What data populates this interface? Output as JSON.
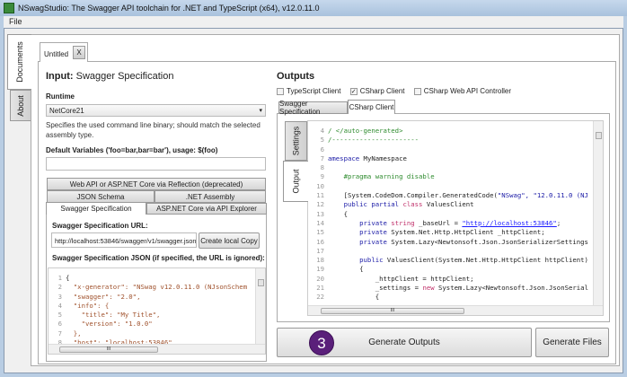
{
  "window": {
    "title": "NSwagStudio: The Swagger API toolchain for .NET and TypeScript (x64), v12.0.11.0"
  },
  "menu": {
    "file": "File"
  },
  "side_tabs": {
    "documents": "Documents",
    "about": "About"
  },
  "document_tab": {
    "label": "Untitled",
    "close": "X"
  },
  "input": {
    "title_bold": "Input:",
    "title_rest": " Swagger Specification",
    "runtime_label": "Runtime",
    "runtime_value": "NetCore21",
    "runtime_help": "Specifies the used command line binary; should match the selected assembly type.",
    "vars_label": "Default Variables ('foo=bar,bar=bar'), usage: $(foo)",
    "vars_value": "",
    "tabs": {
      "reflection": "Web API or ASP.NET Core via Reflection (deprecated)",
      "json_schema": "JSON Schema",
      "assembly": ".NET Assembly",
      "swagger": "Swagger Specification",
      "api_explorer": "ASP.NET Core via API Explorer"
    },
    "url_label": "Swagger Specification URL:",
    "url_value": "http://localhost:53846/swagger/v1/swagger.json",
    "copy_button": "Create local Copy",
    "json_label": "Swagger Specification JSON (if specified, the URL is ignored):",
    "json_lines": [
      [
        "1",
        "{"
      ],
      [
        "2",
        "  \"x-generator\": \"NSwag v12.0.11.0 (NJsonSchem"
      ],
      [
        "3",
        "  \"swagger\": \"2.0\","
      ],
      [
        "4",
        "  \"info\": {"
      ],
      [
        "5",
        "    \"title\": \"My Title\","
      ],
      [
        "6",
        "    \"version\": \"1.0.0\""
      ],
      [
        "7",
        "  },"
      ],
      [
        "8",
        "  \"host\": \"localhost:53846\""
      ]
    ]
  },
  "outputs": {
    "title": "Outputs",
    "checkboxes": [
      {
        "label": "TypeScript Client",
        "checked": false
      },
      {
        "label": "CSharp Client",
        "checked": true
      },
      {
        "label": "CSharp Web API Controller",
        "checked": false
      }
    ],
    "tabs": {
      "swagger": "Swagger Specification",
      "csharp": "CSharp Client"
    },
    "vtabs": {
      "settings": "Settings",
      "output": "Output"
    },
    "code_lines": [
      {
        "n": "4",
        "s": [
          [
            "/ </auto-generated>",
            "#2e8b2e"
          ]
        ]
      },
      {
        "n": "5",
        "s": [
          [
            "/----------------------",
            "#2e8b2e"
          ]
        ]
      },
      {
        "n": "6",
        "s": []
      },
      {
        "n": "7",
        "s": [
          [
            "amespace",
            "#1a1aa6"
          ],
          [
            " MyNamespace",
            "#222"
          ]
        ]
      },
      {
        "n": "8",
        "s": []
      },
      {
        "n": "9",
        "s": [
          [
            "    #pragma warning disable",
            "#2e8b2e"
          ]
        ]
      },
      {
        "n": "10",
        "s": []
      },
      {
        "n": "11",
        "s": [
          [
            "    [System.CodeDom.Compiler.GeneratedCode(",
            "#222"
          ],
          [
            "\"NSwag\", \"12.0.11.0 (NJ",
            "#1a1aa6"
          ]
        ]
      },
      {
        "n": "12",
        "s": [
          [
            "    public partial ",
            "#1a1aa6"
          ],
          [
            "class",
            "#c0306a"
          ],
          [
            " ValuesClient",
            "#222"
          ]
        ]
      },
      {
        "n": "13",
        "s": [
          [
            "    {",
            "#222"
          ]
        ]
      },
      {
        "n": "14",
        "s": [
          [
            "        private ",
            "#1a1aa6"
          ],
          [
            "string",
            "#c0306a"
          ],
          [
            " _baseUrl = ",
            "#222"
          ],
          [
            "\"http://localhost:53846\"",
            "#1a1aff"
          ],
          [
            ";",
            "#222"
          ]
        ]
      },
      {
        "n": "15",
        "s": [
          [
            "        private ",
            "#1a1aa6"
          ],
          [
            "System.Net.Http.HttpClient _httpClient;",
            "#222"
          ]
        ]
      },
      {
        "n": "16",
        "s": [
          [
            "        private ",
            "#1a1aa6"
          ],
          [
            "System.Lazy<Newtonsoft.Json.JsonSerializerSettings",
            "#222"
          ]
        ]
      },
      {
        "n": "17",
        "s": []
      },
      {
        "n": "18",
        "s": [
          [
            "        public ",
            "#1a1aa6"
          ],
          [
            "ValuesClient(System.Net.Http.HttpClient httpClient)",
            "#222"
          ]
        ]
      },
      {
        "n": "19",
        "s": [
          [
            "        {",
            "#222"
          ]
        ]
      },
      {
        "n": "20",
        "s": [
          [
            "            _httpClient = httpClient;",
            "#222"
          ]
        ]
      },
      {
        "n": "21",
        "s": [
          [
            "            _settings = ",
            "#222"
          ],
          [
            "new",
            "#c0306a"
          ],
          [
            " System.Lazy<Newtonsoft.Json.JsonSerial",
            "#222"
          ]
        ]
      },
      {
        "n": "22",
        "s": [
          [
            "            {",
            "#222"
          ]
        ]
      }
    ],
    "step_badge": "3",
    "generate_outputs": "Generate Outputs",
    "generate_files": "Generate Files"
  },
  "scrollbar": {
    "grip": "III"
  }
}
